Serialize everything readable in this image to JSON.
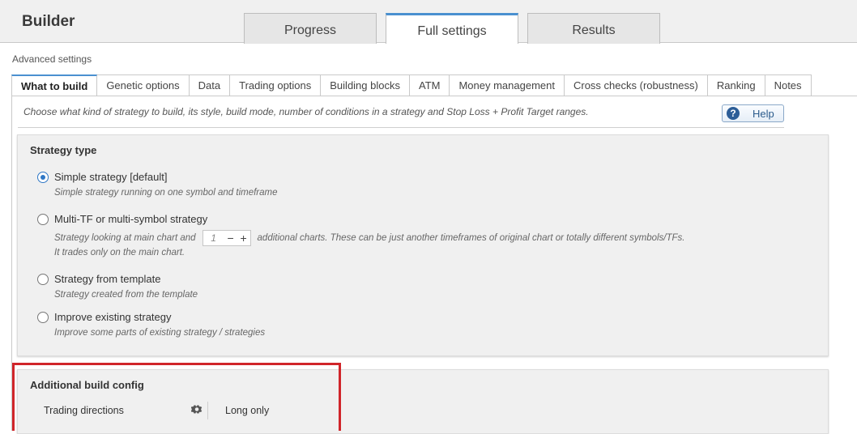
{
  "app": {
    "title": "Builder"
  },
  "main_tabs": [
    {
      "label": "Progress",
      "active": false
    },
    {
      "label": "Full settings",
      "active": true
    },
    {
      "label": "Results",
      "active": false
    }
  ],
  "advanced_label": "Advanced settings",
  "sub_tabs": [
    {
      "label": "What to build",
      "active": true
    },
    {
      "label": "Genetic options"
    },
    {
      "label": "Data"
    },
    {
      "label": "Trading options"
    },
    {
      "label": "Building blocks"
    },
    {
      "label": "ATM"
    },
    {
      "label": "Money management"
    },
    {
      "label": "Cross checks (robustness)"
    },
    {
      "label": "Ranking"
    },
    {
      "label": "Notes"
    }
  ],
  "description": "Choose what kind of strategy to build, its style, build mode, number of conditions in a strategy and Stop Loss + Profit Target ranges.",
  "help_label": "Help",
  "strategy_type": {
    "title": "Strategy type",
    "options": [
      {
        "label": "Simple strategy [default]",
        "desc": "Simple strategy running on one symbol and timeframe",
        "checked": true
      },
      {
        "label": "Multi-TF or multi-symbol strategy",
        "desc_before": "Strategy looking at main chart and",
        "stepper_value": "1",
        "desc_after": "additional charts. These can be just another timeframes of original chart or totally different symbols/TFs.",
        "desc_line2": "It trades only on the main chart.",
        "checked": false
      },
      {
        "label": "Strategy from template",
        "desc": "Strategy created from the template",
        "checked": false
      },
      {
        "label": "Improve existing strategy",
        "desc": "Improve some parts of existing strategy / strategies",
        "checked": false
      }
    ]
  },
  "additional_build": {
    "title": "Additional build config",
    "trading_directions_label": "Trading directions",
    "trading_directions_value": "Long only"
  },
  "colors": {
    "accent": "#4a90d0",
    "highlight_box": "#d0252a",
    "help_icon": "#2c5d97"
  }
}
